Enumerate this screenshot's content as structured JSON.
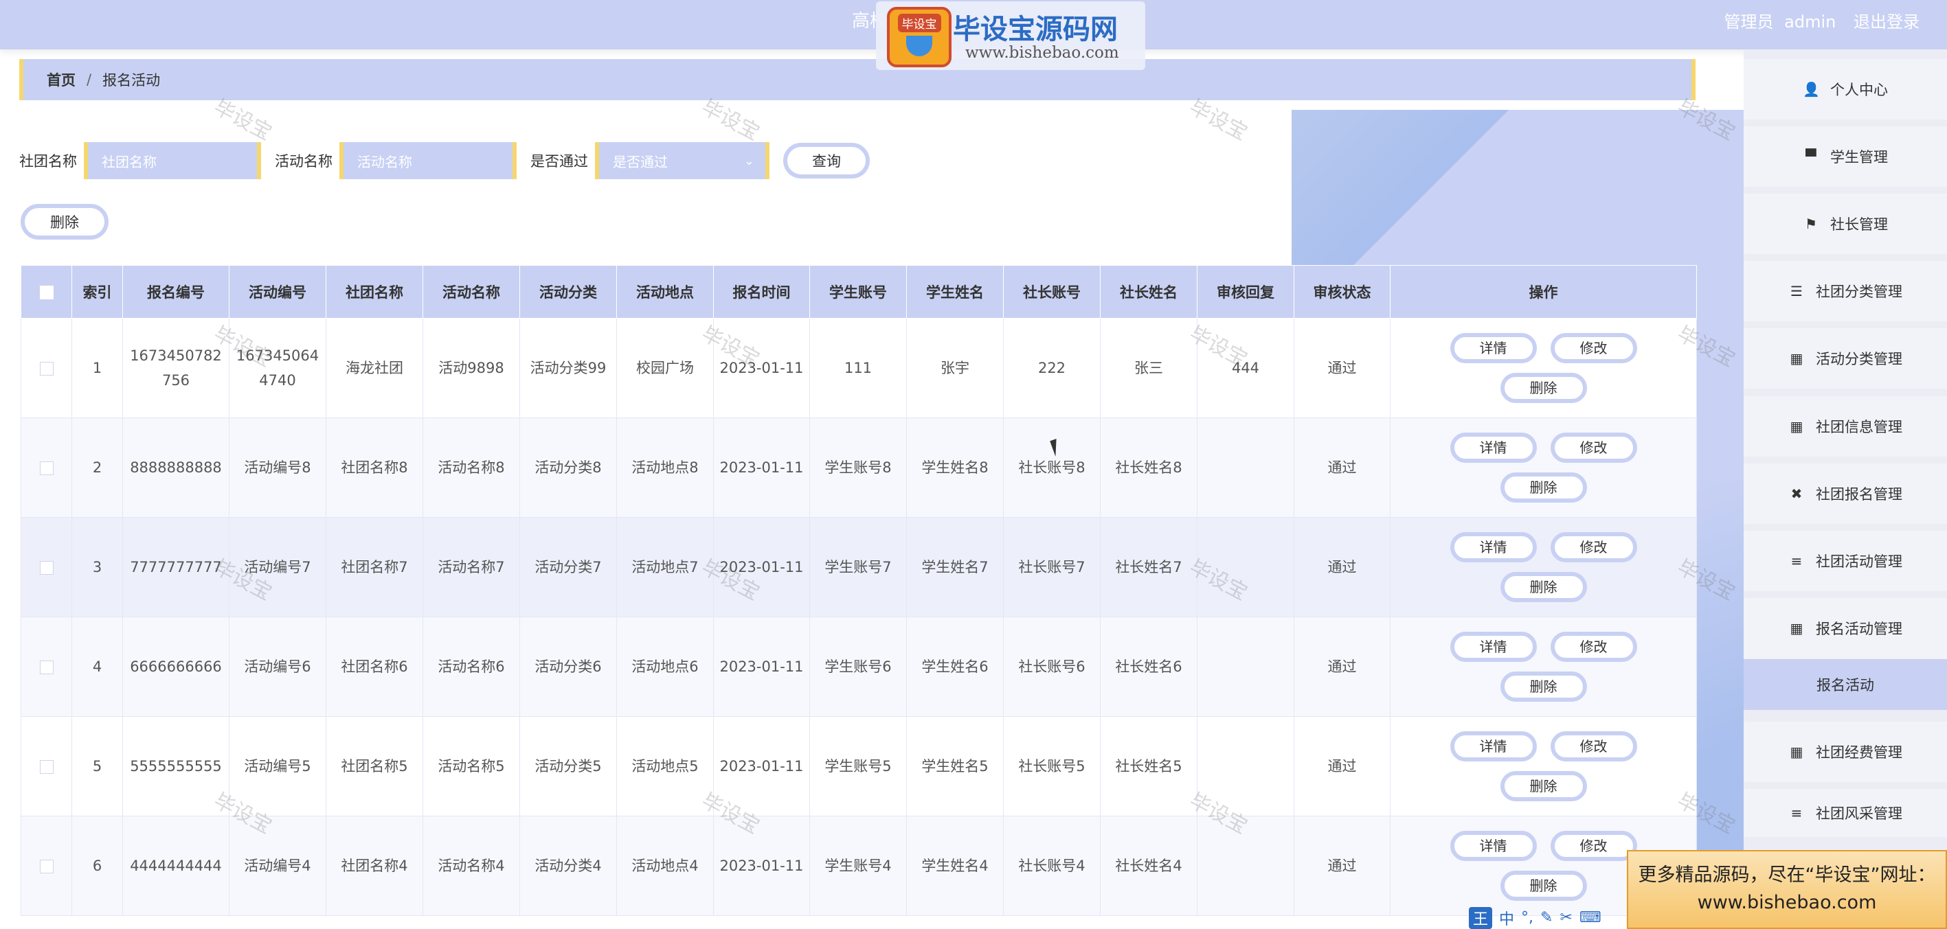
{
  "header": {
    "title": "高校",
    "user_role": "管理员",
    "username": "admin",
    "logout": "退出登录"
  },
  "logo": {
    "badge": "毕设宝",
    "name": "毕设宝源码网",
    "url": "www.bishebao.com"
  },
  "breadcrumb": {
    "home": "首页",
    "separator": "/",
    "current": "报名活动"
  },
  "filters": {
    "club_label": "社团名称",
    "club_placeholder": "社团名称",
    "activity_label": "活动名称",
    "activity_placeholder": "活动名称",
    "passed_label": "是否通过",
    "passed_placeholder": "是否通过",
    "search": "查询"
  },
  "toolbar": {
    "delete": "删除"
  },
  "table": {
    "columns": [
      "索引",
      "报名编号",
      "活动编号",
      "社团名称",
      "活动名称",
      "活动分类",
      "活动地点",
      "报名时间",
      "学生账号",
      "学生姓名",
      "社长账号",
      "社长姓名",
      "审核回复",
      "审核状态",
      "操作"
    ],
    "actions": {
      "detail": "详情",
      "edit": "修改",
      "delete": "删除"
    },
    "rows": [
      {
        "index": "1",
        "reg_no": "1673450782756",
        "act_no": "1673450644740",
        "club": "海龙社团",
        "act_name": "活动9898",
        "category": "活动分类99",
        "place": "校园广场",
        "time": "2023-01-11",
        "stu_acc": "111",
        "stu_name": "张宇",
        "head_acc": "222",
        "head_name": "张三",
        "reply": "444",
        "status": "通过"
      },
      {
        "index": "2",
        "reg_no": "8888888888",
        "act_no": "活动编号8",
        "club": "社团名称8",
        "act_name": "活动名称8",
        "category": "活动分类8",
        "place": "活动地点8",
        "time": "2023-01-11",
        "stu_acc": "学生账号8",
        "stu_name": "学生姓名8",
        "head_acc": "社长账号8",
        "head_name": "社长姓名8",
        "reply": "",
        "status": "通过"
      },
      {
        "index": "3",
        "reg_no": "7777777777",
        "act_no": "活动编号7",
        "club": "社团名称7",
        "act_name": "活动名称7",
        "category": "活动分类7",
        "place": "活动地点7",
        "time": "2023-01-11",
        "stu_acc": "学生账号7",
        "stu_name": "学生姓名7",
        "head_acc": "社长账号7",
        "head_name": "社长姓名7",
        "reply": "",
        "status": "通过"
      },
      {
        "index": "4",
        "reg_no": "6666666666",
        "act_no": "活动编号6",
        "club": "社团名称6",
        "act_name": "活动名称6",
        "category": "活动分类6",
        "place": "活动地点6",
        "time": "2023-01-11",
        "stu_acc": "学生账号6",
        "stu_name": "学生姓名6",
        "head_acc": "社长账号6",
        "head_name": "社长姓名6",
        "reply": "",
        "status": "通过"
      },
      {
        "index": "5",
        "reg_no": "5555555555",
        "act_no": "活动编号5",
        "club": "社团名称5",
        "act_name": "活动名称5",
        "category": "活动分类5",
        "place": "活动地点5",
        "time": "2023-01-11",
        "stu_acc": "学生账号5",
        "stu_name": "学生姓名5",
        "head_acc": "社长账号5",
        "head_name": "社长姓名5",
        "reply": "",
        "status": "通过"
      },
      {
        "index": "6",
        "reg_no": "4444444444",
        "act_no": "活动编号4",
        "club": "社团名称4",
        "act_name": "活动名称4",
        "category": "活动分类4",
        "place": "活动地点4",
        "time": "2023-01-11",
        "stu_acc": "学生账号4",
        "stu_name": "学生姓名4",
        "head_acc": "社长账号4",
        "head_name": "社长姓名4",
        "reply": "",
        "status": "通过"
      }
    ]
  },
  "sidebar": {
    "items": [
      {
        "label": "个人中心",
        "icon": "user-icon",
        "glyph": "👤"
      },
      {
        "label": "学生管理",
        "icon": "pin-icon",
        "glyph": "▀"
      },
      {
        "label": "社长管理",
        "icon": "flag-icon",
        "glyph": "⚑"
      },
      {
        "label": "社团分类管理",
        "icon": "sliders-icon",
        "glyph": "☰"
      },
      {
        "label": "活动分类管理",
        "icon": "grid-icon",
        "glyph": "▦"
      },
      {
        "label": "社团信息管理",
        "icon": "grid-icon",
        "glyph": "▦"
      },
      {
        "label": "社团报名管理",
        "icon": "clipboard-icon",
        "glyph": "✖"
      },
      {
        "label": "社团活动管理",
        "icon": "list-icon",
        "glyph": "≡"
      },
      {
        "label": "报名活动管理",
        "icon": "grid-icon",
        "glyph": "▦"
      },
      {
        "label": "报名活动",
        "icon": "",
        "glyph": ""
      },
      {
        "label": "社团经费管理",
        "icon": "grid-icon",
        "glyph": "▦"
      },
      {
        "label": "社团风采管理",
        "icon": "list-icon",
        "glyph": "≡"
      }
    ]
  },
  "watermark": "毕设宝",
  "ad": {
    "line1": "更多精品源码，尽在“毕设宝”网址：",
    "line2": "www.bishebao.com"
  },
  "ime": {
    "brand": "王",
    "items": [
      "中",
      "°,",
      "✎",
      "✂",
      "⌨"
    ]
  }
}
